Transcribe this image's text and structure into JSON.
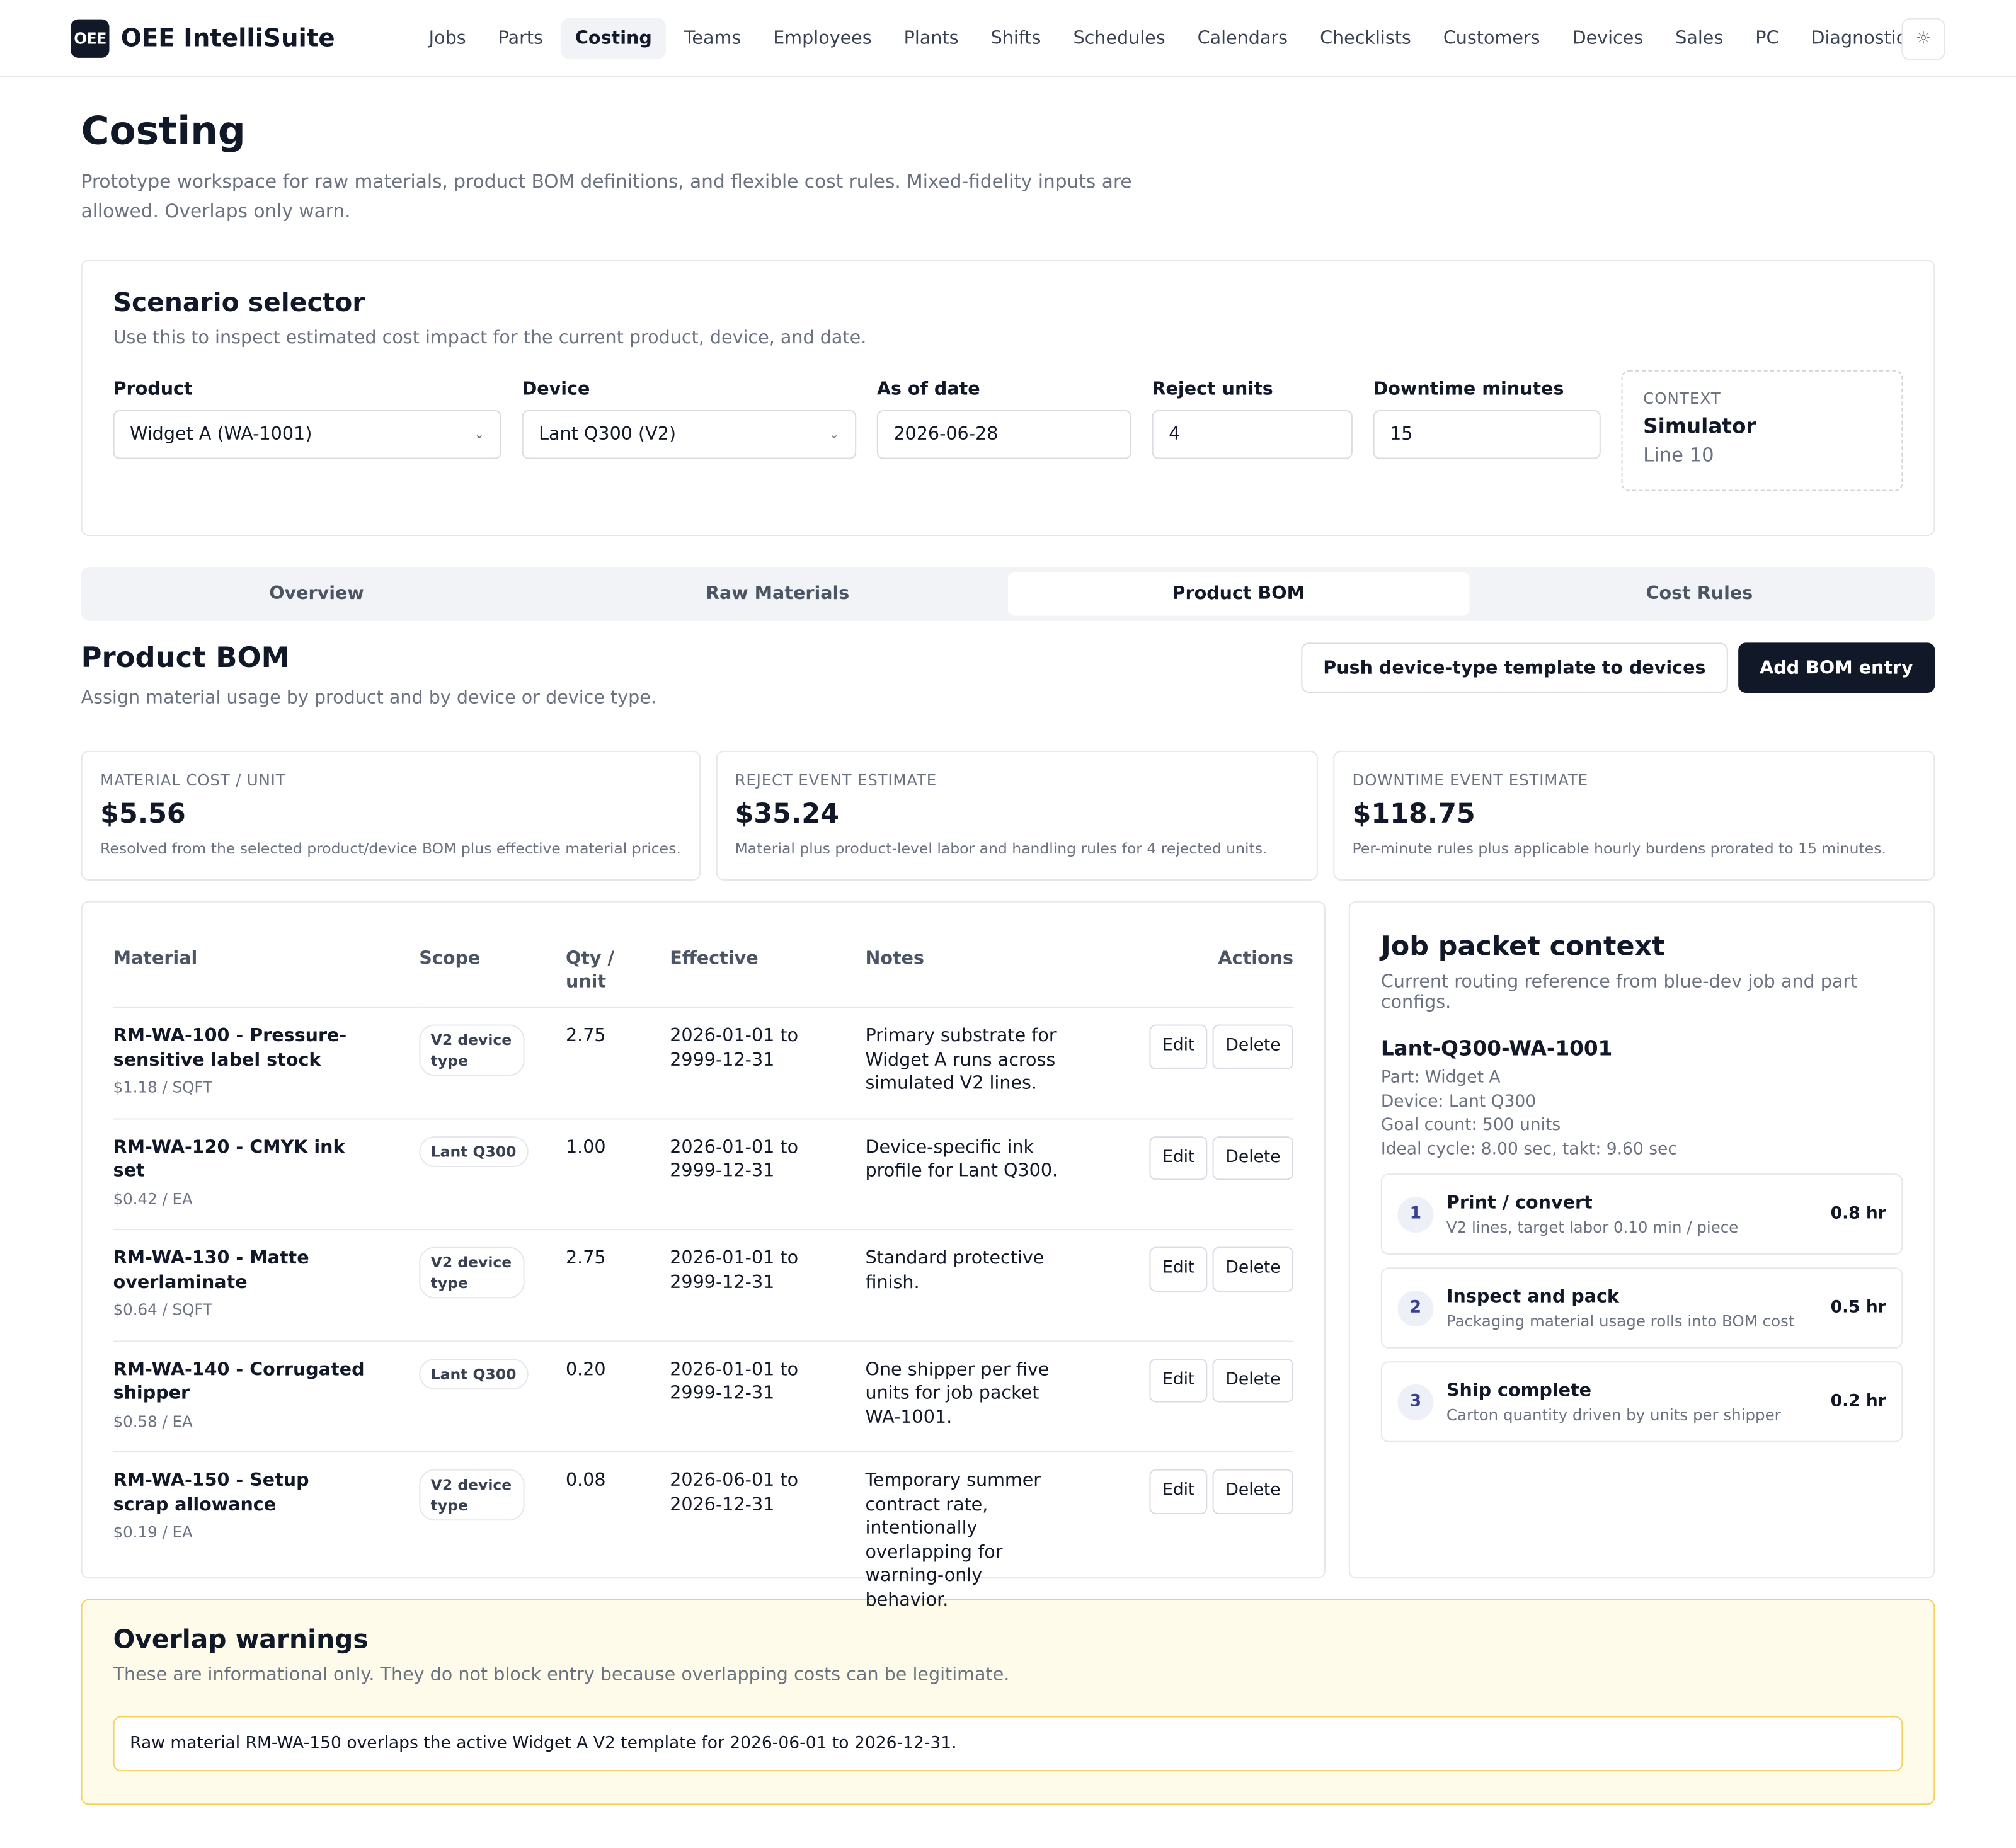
{
  "brand": {
    "logo": "OEE",
    "name": "OEE IntelliSuite"
  },
  "nav": [
    "Jobs",
    "Parts",
    "Costing",
    "Teams",
    "Employees",
    "Plants",
    "Shifts",
    "Schedules",
    "Calendars",
    "Checklists",
    "Customers",
    "Devices",
    "Sales",
    "PC",
    "Diagnostics"
  ],
  "nav_active": "Costing",
  "theme_icon": "☼",
  "page": {
    "title": "Costing",
    "desc": "Prototype workspace for raw materials, product BOM definitions, and flexible cost rules. Mixed-fidelity inputs are allowed. Overlaps only warn."
  },
  "scenario": {
    "title": "Scenario selector",
    "sub": "Use this to inspect estimated cost impact for the current product, device, and date.",
    "product_label": "Product",
    "product_value": "Widget A (WA-1001)",
    "device_label": "Device",
    "device_value": "Lant Q300 (V2)",
    "date_label": "As of date",
    "date_value": "2026-06-28",
    "reject_label": "Reject units",
    "reject_value": "4",
    "downtime_label": "Downtime minutes",
    "downtime_value": "15",
    "context_label": "CONTEXT",
    "context_name": "Simulator",
    "context_line": "Line 10"
  },
  "tabs": [
    "Overview",
    "Raw Materials",
    "Product BOM",
    "Cost Rules"
  ],
  "tab_active": "Product BOM",
  "bom": {
    "title": "Product BOM",
    "sub": "Assign material usage by product and by device or device type.",
    "push_label": "Push device-type template to devices",
    "add_label": "Add BOM entry"
  },
  "metrics": [
    {
      "label": "MATERIAL COST / UNIT",
      "value": "$5.56",
      "desc": "Resolved from the selected product/device BOM plus effective material prices."
    },
    {
      "label": "REJECT EVENT ESTIMATE",
      "value": "$35.24",
      "desc": "Material plus product-level labor and handling rules for 4 rejected units."
    },
    {
      "label": "DOWNTIME EVENT ESTIMATE",
      "value": "$118.75",
      "desc": "Per-minute rules plus applicable hourly burdens prorated to 15 minutes."
    }
  ],
  "table": {
    "headers": {
      "material": "Material",
      "scope": "Scope",
      "qty": "Qty / unit",
      "effective": "Effective",
      "notes": "Notes",
      "actions": "Actions"
    },
    "edit_label": "Edit",
    "delete_label": "Delete",
    "rows": [
      {
        "name": "RM-WA-100 - Pressure-sensitive label stock",
        "price": "$1.18 / SQFT",
        "scope": "V2 device type",
        "qty": "2.75",
        "effective": "2026-01-01 to 2999-12-31",
        "notes": "Primary substrate for Widget A runs across simulated V2 lines."
      },
      {
        "name": "RM-WA-120 - CMYK ink set",
        "price": "$0.42 / EA",
        "scope": "Lant Q300",
        "qty": "1.00",
        "effective": "2026-01-01 to 2999-12-31",
        "notes": "Device-specific ink profile for Lant Q300."
      },
      {
        "name": "RM-WA-130 - Matte overlaminate",
        "price": "$0.64 / SQFT",
        "scope": "V2 device type",
        "qty": "2.75",
        "effective": "2026-01-01 to 2999-12-31",
        "notes": "Standard protective finish."
      },
      {
        "name": "RM-WA-140 - Corrugated shipper",
        "price": "$0.58 / EA",
        "scope": "Lant Q300",
        "qty": "0.20",
        "effective": "2026-01-01 to 2999-12-31",
        "notes": "One shipper per five units for job packet WA-1001."
      },
      {
        "name": "RM-WA-150 - Setup scrap allowance",
        "price": "$0.19 / EA",
        "scope": "V2 device type",
        "qty": "0.08",
        "effective": "2026-06-01 to 2026-12-31",
        "notes": "Temporary summer contract rate, intentionally overlapping for warning-only behavior."
      }
    ]
  },
  "packet": {
    "title": "Job packet context",
    "sub": "Current routing reference from blue-dev job and part configs.",
    "id": "Lant-Q300-WA-1001",
    "part": "Part: Widget A",
    "device": "Device: Lant Q300",
    "goal": "Goal count: 500 units",
    "cycle": "Ideal cycle: 8.00 sec, takt: 9.60 sec",
    "steps": [
      {
        "num": "1",
        "title": "Print / convert",
        "desc": "V2 lines, target labor 0.10 min / piece",
        "hours": "0.8 hr"
      },
      {
        "num": "2",
        "title": "Inspect and pack",
        "desc": "Packaging material usage rolls into BOM cost",
        "hours": "0.5 hr"
      },
      {
        "num": "3",
        "title": "Ship complete",
        "desc": "Carton quantity driven by units per shipper",
        "hours": "0.2 hr"
      }
    ]
  },
  "warnings": {
    "title": "Overlap warnings",
    "sub": "These are informational only. They do not block entry because overlapping costs can be legitimate.",
    "items": [
      "Raw material RM-WA-150 overlaps the active Widget A V2 template for 2026-06-01 to 2026-12-31."
    ]
  }
}
